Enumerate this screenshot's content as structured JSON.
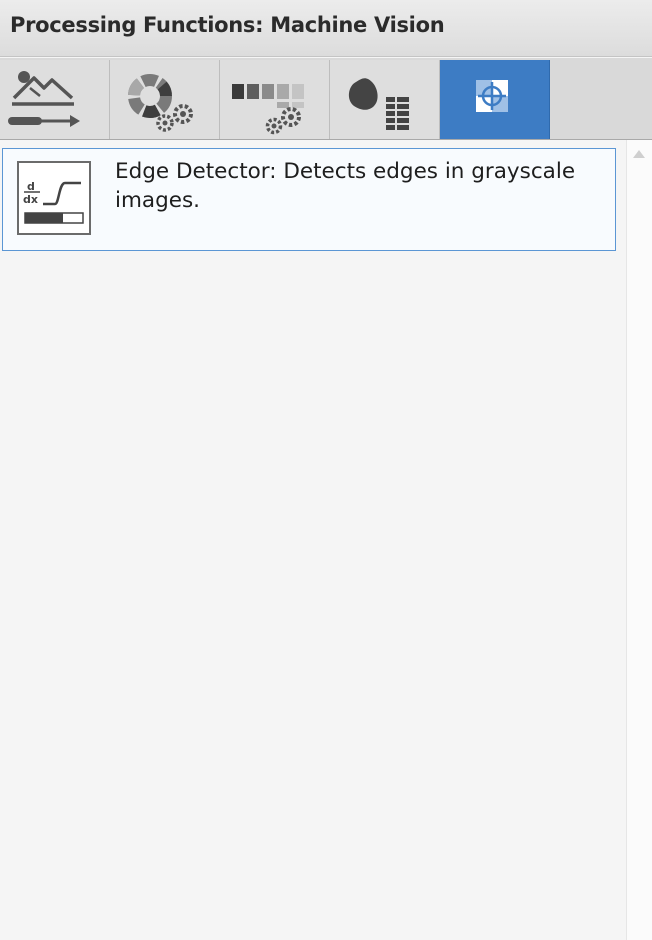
{
  "panel": {
    "title": "Processing Functions: Machine Vision"
  },
  "tabs": [
    {
      "icon": "landscape-adjust-icon",
      "active": false
    },
    {
      "icon": "color-wheel-gears-icon",
      "active": false
    },
    {
      "icon": "grayscale-bar-gears-icon",
      "active": false
    },
    {
      "icon": "blob-table-icon",
      "active": false
    },
    {
      "icon": "crosshair-target-icon",
      "active": true
    }
  ],
  "functions": [
    {
      "icon": "derivative-edge-icon",
      "icon_text": "d/dx",
      "description": "Edge Detector:  Detects edges in grayscale images."
    }
  ],
  "colors": {
    "active_tab": "#3d7cc4",
    "selection_border": "#5b96d4",
    "icon_gray": "#4a4a4a"
  }
}
